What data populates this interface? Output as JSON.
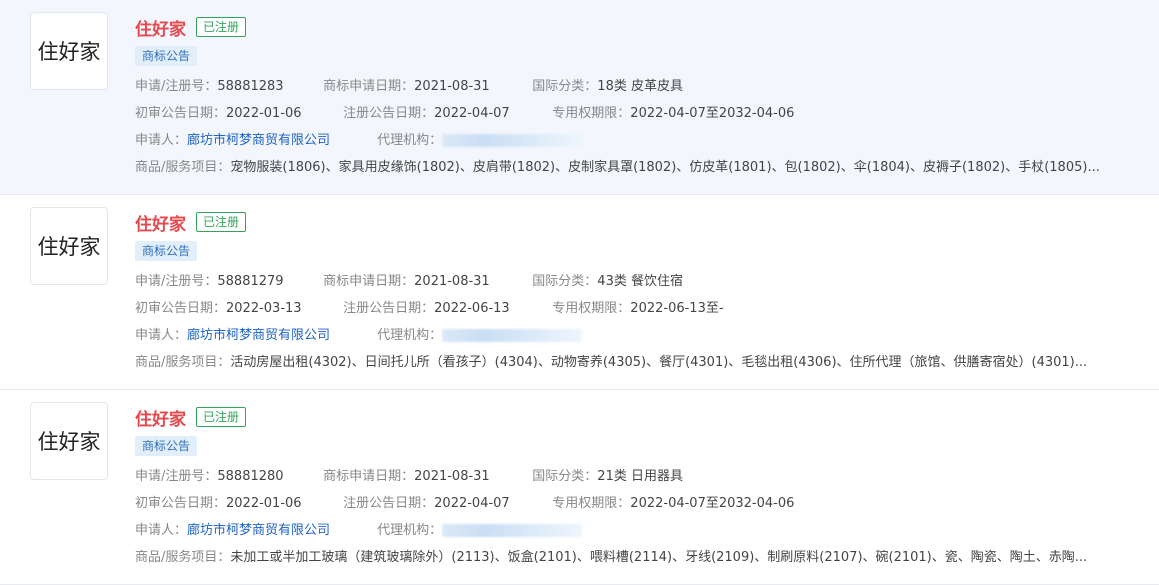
{
  "labels": {
    "reg_no": "申请/注册号：",
    "app_date": "商标申请日期：",
    "intl_class": "国际分类：",
    "prelim_date": "初审公告日期：",
    "reg_pub_date": "注册公告日期：",
    "term": "专用权期限：",
    "applicant": "申请人：",
    "agent": "代理机构：",
    "goods": "商品/服务项目："
  },
  "records": [
    {
      "logo_text": "住好家",
      "name": "住好家",
      "status": "已注册",
      "tag": "商标公告",
      "reg_no": "58881283",
      "app_date": "2021-08-31",
      "intl_class": "18类 皮革皮具",
      "prelim_date": "2022-01-06",
      "reg_pub_date": "2022-04-07",
      "term": "2022-04-07至2032-04-06",
      "applicant": "廊坊市柯梦商贸有限公司",
      "goods": "宠物服装(1806)、家具用皮缘饰(1802)、皮肩带(1802)、皮制家具罩(1802)、仿皮革(1801)、包(1802)、伞(1804)、皮褥子(1802)、手杖(1805)..."
    },
    {
      "logo_text": "住好家",
      "name": "住好家",
      "status": "已注册",
      "tag": "商标公告",
      "reg_no": "58881279",
      "app_date": "2021-08-31",
      "intl_class": "43类 餐饮住宿",
      "prelim_date": "2022-03-13",
      "reg_pub_date": "2022-06-13",
      "term": "2022-06-13至-",
      "applicant": "廊坊市柯梦商贸有限公司",
      "goods": "活动房屋出租(4302)、日间托儿所（看孩子）(4304)、动物寄养(4305)、餐厅(4301)、毛毯出租(4306)、住所代理（旅馆、供膳寄宿处）(4301)..."
    },
    {
      "logo_text": "住好家",
      "name": "住好家",
      "status": "已注册",
      "tag": "商标公告",
      "reg_no": "58881280",
      "app_date": "2021-08-31",
      "intl_class": "21类 日用器具",
      "prelim_date": "2022-01-06",
      "reg_pub_date": "2022-04-07",
      "term": "2022-04-07至2032-04-06",
      "applicant": "廊坊市柯梦商贸有限公司",
      "goods": "未加工或半加工玻璃（建筑玻璃除外）(2113)、饭盒(2101)、喂料槽(2114)、牙线(2109)、制刷原料(2107)、碗(2101)、瓷、陶瓷、陶土、赤陶..."
    }
  ]
}
